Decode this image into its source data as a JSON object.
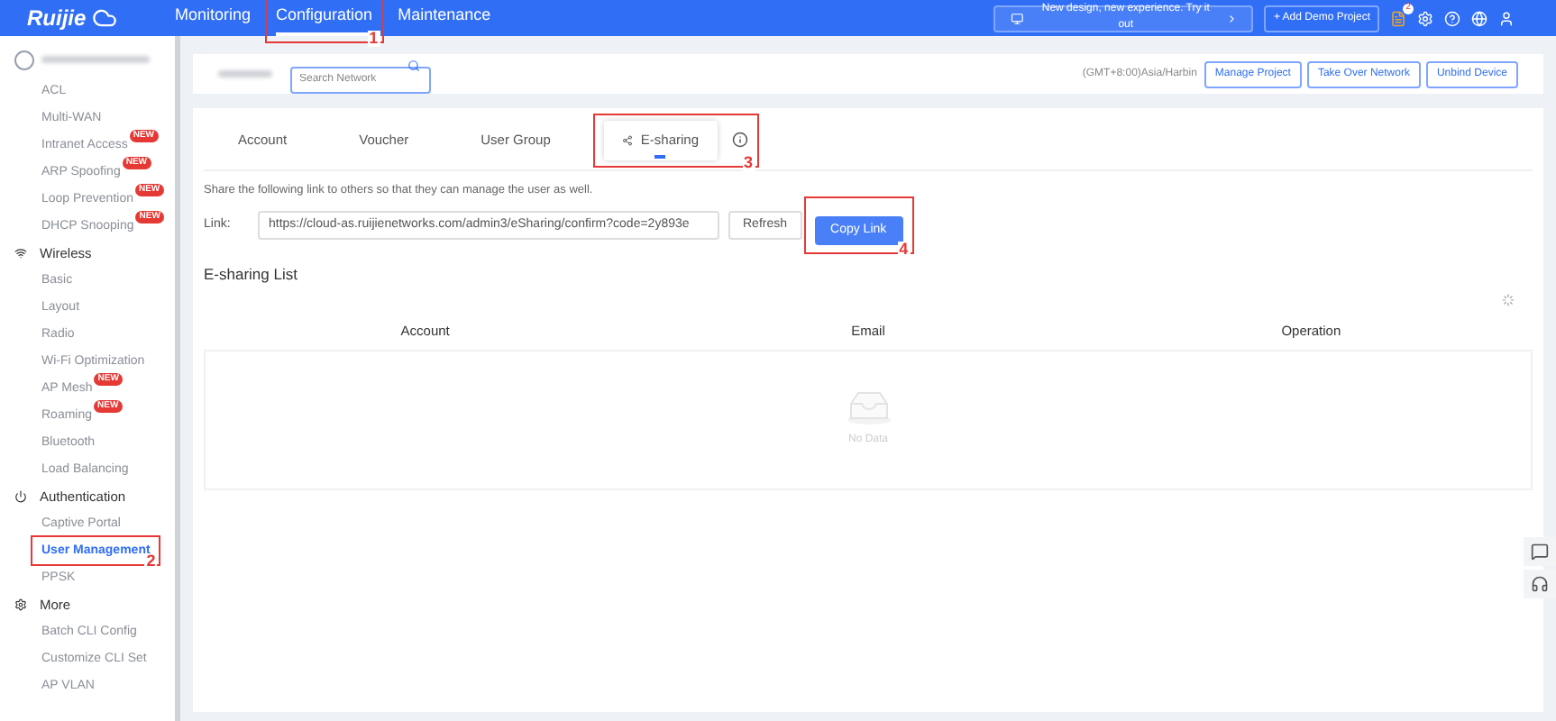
{
  "top_bar": {
    "logo": "Ruijie",
    "nav": [
      {
        "label": "Monitoring",
        "selected": false
      },
      {
        "label": "Configuration",
        "selected": true,
        "annotation": "1"
      },
      {
        "label": "Maintenance",
        "selected": false
      }
    ],
    "banner": "New design, new experience. Try it out",
    "add_button": "+ Add Demo Project",
    "notification_count": "2"
  },
  "sidebar": {
    "items": [
      {
        "kind": "item",
        "label": "ACL",
        "selected": false
      },
      {
        "kind": "item",
        "label": "Multi-WAN",
        "selected": false
      },
      {
        "kind": "item",
        "label": "Intranet Access",
        "badge": "NEW",
        "selected": false
      },
      {
        "kind": "item",
        "label": "ARP Spoofing",
        "badge": "NEW",
        "selected": false
      },
      {
        "kind": "item",
        "label": "Loop Prevention",
        "badge": "NEW",
        "selected": false
      },
      {
        "kind": "item",
        "label": "DHCP Snooping",
        "badge": "NEW",
        "selected": false
      },
      {
        "kind": "heading",
        "label": "Wireless"
      },
      {
        "kind": "item",
        "label": "Basic",
        "selected": false
      },
      {
        "kind": "item",
        "label": "Layout",
        "selected": false
      },
      {
        "kind": "item",
        "label": "Radio",
        "selected": false
      },
      {
        "kind": "item",
        "label": "Wi-Fi Optimization",
        "selected": false
      },
      {
        "kind": "item",
        "label": "AP Mesh",
        "badge": "NEW",
        "selected": false
      },
      {
        "kind": "item",
        "label": "Roaming",
        "badge": "NEW",
        "selected": false
      },
      {
        "kind": "item",
        "label": "Bluetooth",
        "selected": false
      },
      {
        "kind": "item",
        "label": "Load Balancing",
        "selected": false
      },
      {
        "kind": "heading",
        "label": "Authentication"
      },
      {
        "kind": "item",
        "label": "Captive Portal",
        "selected": false
      },
      {
        "kind": "item",
        "label": "User Management",
        "selected": true,
        "annotation": "2"
      },
      {
        "kind": "item",
        "label": "PPSK",
        "selected": false
      },
      {
        "kind": "heading",
        "label": "More"
      },
      {
        "kind": "item",
        "label": "Batch CLI Config",
        "selected": false
      },
      {
        "kind": "item",
        "label": "Customize CLI Set",
        "selected": false
      },
      {
        "kind": "item",
        "label": "AP VLAN",
        "selected": false
      }
    ]
  },
  "header": {
    "search_placeholder": "Search Network",
    "timezone": "(GMT+8:00)Asia/Harbin",
    "buttons": [
      "Manage Project",
      "Take Over Network",
      "Unbind Device"
    ]
  },
  "tabs": [
    {
      "label": "Account",
      "selected": false
    },
    {
      "label": "Voucher",
      "selected": false
    },
    {
      "label": "User Group",
      "selected": false
    },
    {
      "label": "E-sharing",
      "selected": true,
      "annotation": "3"
    }
  ],
  "description": "Share the following link to others so that they can manage the user as well.",
  "link": {
    "label": "Link:",
    "value": "https://cloud-as.ruijienetworks.com/admin3/eSharing/confirm?code=2y893e",
    "refresh": "Refresh",
    "copy": "Copy Link",
    "copy_annotation": "4"
  },
  "list": {
    "title": "E-sharing List",
    "columns": [
      "Account",
      "Email",
      "Operation"
    ],
    "empty_text": "No Data"
  }
}
